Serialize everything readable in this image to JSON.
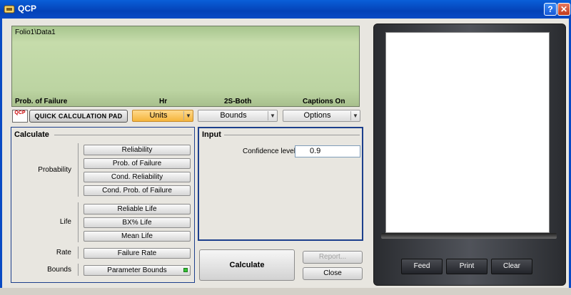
{
  "window": {
    "title": "QCP",
    "help_label": "?",
    "close_label": "✕"
  },
  "display": {
    "path": "Folio1\\Data1",
    "footer": [
      "Prob. of Failure",
      "Hr",
      "2S-Both",
      "Captions On"
    ]
  },
  "toolbar": {
    "qcp_logo_text": "QCP",
    "pad_button": "Quick Calculation Pad",
    "units_label": "Units",
    "bounds_label": "Bounds",
    "options_label": "Options"
  },
  "calculate": {
    "title": "Calculate",
    "groups": {
      "probability": "Probability",
      "life": "Life",
      "rate": "Rate",
      "bounds": "Bounds"
    },
    "buttons": {
      "reliability": "Reliability",
      "prob_failure": "Prob. of Failure",
      "cond_reliability": "Cond. Reliability",
      "cond_prob_failure": "Cond. Prob. of Failure",
      "reliable_life": "Reliable Life",
      "bx_life": "BX% Life",
      "mean_life": "Mean Life",
      "failure_rate": "Failure Rate",
      "parameter_bounds": "Parameter Bounds"
    }
  },
  "input": {
    "title": "Input",
    "confidence_label": "Confidence level",
    "confidence_value": "0.9"
  },
  "actions": {
    "calculate": "Calculate",
    "report": "Report...",
    "close": "Close"
  },
  "printer": {
    "feed": "Feed",
    "print": "Print",
    "clear": "Clear"
  },
  "colors": {
    "title_bar": "#0442b8",
    "lcd_green": "#bcd4a2",
    "units_orange": "#f5b53c",
    "calc_panel_border": "#1c3f8c"
  }
}
